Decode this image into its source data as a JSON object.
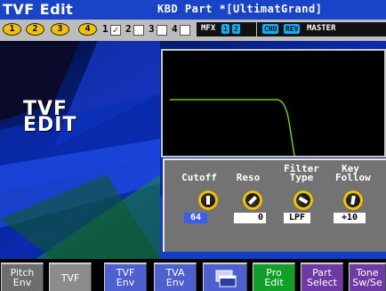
{
  "title": {
    "left": "TVF Edit",
    "right": "KBD Part *[UltimatGrand]"
  },
  "strip": {
    "buttons": [
      "1",
      "2",
      "3",
      "4"
    ],
    "parts": [
      {
        "num": "1",
        "checked": true
      },
      {
        "num": "2",
        "checked": false
      },
      {
        "num": "3",
        "checked": false
      },
      {
        "num": "4",
        "checked": false
      }
    ],
    "mfx_label": "MFX",
    "mfx_pills": [
      "1",
      "2"
    ],
    "cho_label": "CHO",
    "rev_label": "REV",
    "master_label": "MASTER"
  },
  "art_title": {
    "line1": "TVF",
    "line2": "EDIT"
  },
  "params": [
    {
      "label": "Cutoff",
      "value": "64",
      "selected": true
    },
    {
      "label": "Reso",
      "value": "0",
      "selected": false
    },
    {
      "label": "Filter Type",
      "value": "LPF",
      "selected": false
    },
    {
      "label": "Key Follow",
      "value": "+10",
      "selected": false
    }
  ],
  "filter_graph": {
    "filter_type": "LPF"
  },
  "tabs": [
    {
      "label": "Pitch Env"
    },
    {
      "label": "TVF"
    },
    {
      "label": "TVF Env"
    },
    {
      "label": "TVA Env"
    },
    {
      "label": "window-icon"
    },
    {
      "label": "Pro Edit"
    },
    {
      "label": "Part Select"
    },
    {
      "label": "Tone Sw/Se"
    }
  ],
  "colors": {
    "titlebar": "#1a44c8",
    "knob_ring": "#f2c200",
    "selected_value": "#3a5cf0",
    "graph_line": "#6ad000",
    "pro_edit": "#10a028",
    "part_select": "#6e3aa6"
  }
}
